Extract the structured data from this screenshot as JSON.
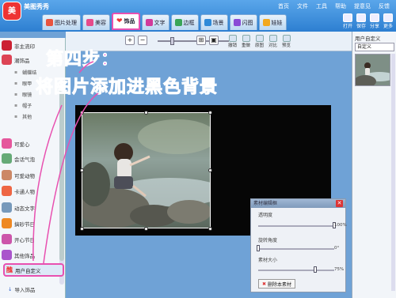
{
  "app": {
    "title": "美图秀秀",
    "logo_text": "美"
  },
  "top_menu": [
    "首页",
    "文件",
    "工具",
    "帮助",
    "提意见",
    "反馈"
  ],
  "tabs": [
    {
      "label": "图片处理",
      "color": "#e9543f"
    },
    {
      "label": "美容",
      "color": "#e64b8b"
    },
    {
      "label": "饰品",
      "color": "#e33",
      "active": true
    },
    {
      "label": "文字",
      "color": "#d13a9b"
    },
    {
      "label": "边框",
      "color": "#3aa558"
    },
    {
      "label": "场景",
      "color": "#2f8ad8"
    },
    {
      "label": "闪图",
      "color": "#8a4bd6"
    },
    {
      "label": "娃娃",
      "color": "#f2a81e"
    }
  ],
  "right_tools": [
    "打开",
    "保存",
    "分享",
    "更多"
  ],
  "sidebar": {
    "items": [
      {
        "label": "非主流印",
        "color": "#c23"
      },
      {
        "label": "潮饰品",
        "color": "#d45"
      },
      {
        "label": "蝴蝶结",
        "sub": true
      },
      {
        "label": "眼甲",
        "sub": true
      },
      {
        "label": "眼镜",
        "sub": true
      },
      {
        "label": "帽子",
        "sub": true
      },
      {
        "label": "其他",
        "sub": true
      },
      {
        "label": "可爱心",
        "color": "#e5579c"
      },
      {
        "label": "会话气泡",
        "color": "#6a7"
      },
      {
        "label": "可爱动物",
        "color": "#c86"
      },
      {
        "label": "卡通人物",
        "color": "#e64"
      },
      {
        "label": "动态文字",
        "color": "#79b"
      },
      {
        "label": "搞砂节日",
        "color": "#e82"
      },
      {
        "label": "开心节日",
        "color": "#c5a"
      },
      {
        "label": "其他饰品",
        "color": "#a5c"
      }
    ],
    "selected_item": "用户自定义",
    "import_label": "导入饰品"
  },
  "toolbar": {
    "zoom_in": "+",
    "zoom_out": "−",
    "actions": [
      "撤销",
      "重做",
      "原图",
      "对比",
      "预览"
    ]
  },
  "captions": {
    "line1": "第四步：",
    "line2": "将图片添加进黑色背景"
  },
  "material_panel": {
    "title": "素材编辑框",
    "close": "✕",
    "transparency_label": "透明度",
    "transparency_value": "100%",
    "transparency": 1.0,
    "rotation_label": "旋转角度",
    "rotation_value": "0°",
    "rotation": 0.0,
    "size_label": "素材大小",
    "size_value": "75%",
    "size": 0.75,
    "delete_label": "删除本素材"
  },
  "right_panel": {
    "title": "用户自定义",
    "select_value": "自定义"
  }
}
